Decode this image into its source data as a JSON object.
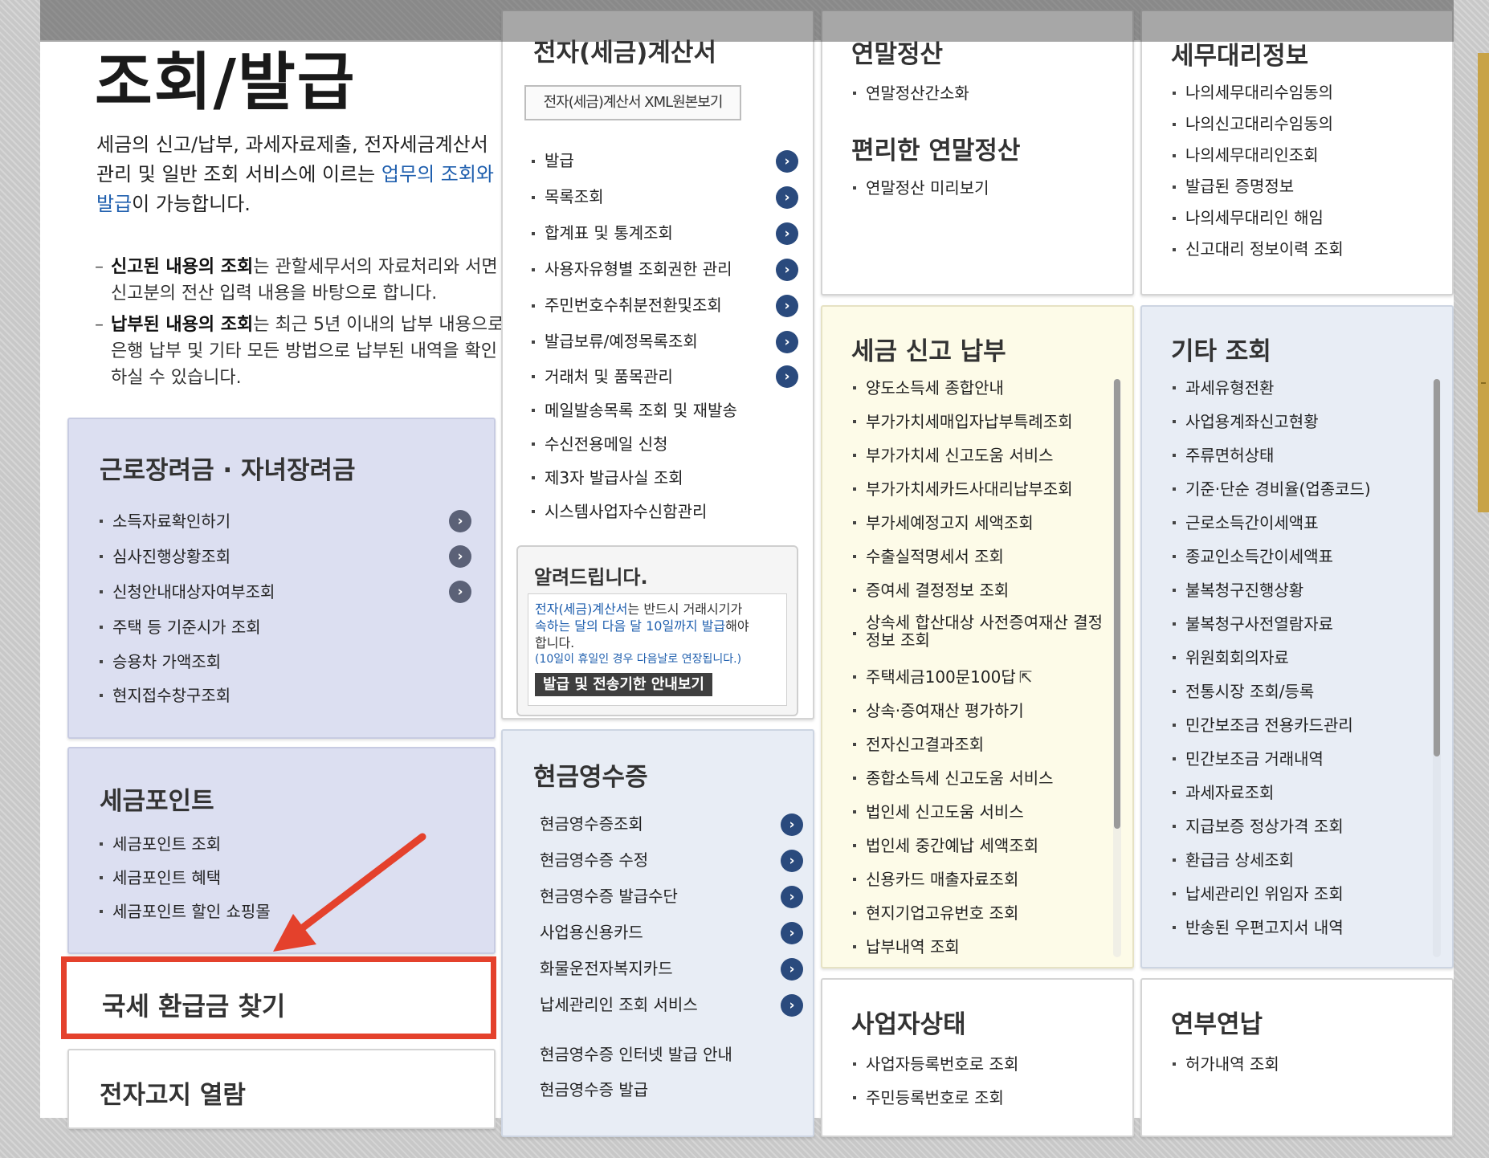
{
  "page": {
    "title": "조회/발급",
    "intro_before": "세금의 신고/납부, 과세자료제출, 전자세금계산서 관리 및 일반 조회 서비스에 이르는 ",
    "intro_highlight": "업무의 조회와 발급",
    "intro_after": "이 가능합니다.",
    "notes": [
      {
        "bold": "신고된 내용의 조회",
        "rest": "는 관할세무서의 자료처리와 서면신고분의 전산 입력 내용을 바탕으로 합니다."
      },
      {
        "bold": "납부된 내용의 조회",
        "rest": "는 최근 5년 이내의 납부 내용으로 은행 납부 및 기타 모든 방법으로 납부된 내역을 확인하실 수 있습니다."
      }
    ]
  },
  "incentive": {
    "title": "근로장려금 · 자녀장려금",
    "items": [
      "소득자료확인하기",
      "심사진행상황조회",
      "신청안내대상자여부조회",
      "주택 등 기준시가 조회",
      "승용차 가액조회",
      "현지접수창구조회"
    ]
  },
  "tax_point": {
    "title": "세금포인트",
    "items": [
      "세금포인트 조회",
      "세금포인트 혜택",
      "세금포인트 할인 쇼핑몰"
    ]
  },
  "refund": {
    "title": "국세 환급금 찾기"
  },
  "e_notice": {
    "title": "전자고지 열람"
  },
  "e_invoice": {
    "title": "전자(세금)계산서",
    "xml_button": "전자(세금)계산서 XML원본보기",
    "items": [
      "발급",
      "목록조회",
      "합계표 및 통계조회",
      "사용자유형별 조회권한 관리",
      "주민번호수취분전환및조회",
      "발급보류/예정목록조회",
      "거래처 및 품목관리",
      "메일발송목록 조회 및 재발송",
      "수신전용메일 신청",
      "제3자 발급사실 조회",
      "시스템사업자수신함관리"
    ]
  },
  "notice": {
    "title": "알려드립니다.",
    "line1_blue": "전자(세금)계산서",
    "line1_rest": "는 반드시 거래시기가",
    "line2_blue": "속하는 달의 다음 달 10일까지 발급",
    "line2_rest": "해야",
    "line3": "합니다.",
    "line4": "(10일이 휴일인 경우 다음날로 연장됩니다.)",
    "button": "발급 및 전송기한 안내보기"
  },
  "cash_receipt": {
    "title": "현금영수증",
    "items": [
      "현금영수증조회",
      "현금영수증 수정",
      "현금영수증 발급수단",
      "사업용신용카드",
      "화물운전자복지카드",
      "납세관리인 조회 서비스"
    ],
    "extra_items": [
      "현금영수증 인터넷 발급 안내",
      "현금영수증 발급"
    ]
  },
  "year_end": {
    "title": "연말정산",
    "items": [
      "연말정산간소화"
    ],
    "sub_title": "편리한 연말정산",
    "sub_items": [
      "연말정산 미리보기"
    ]
  },
  "tax_filing": {
    "title": "세금 신고 납부",
    "items": [
      "양도소득세 종합안내",
      "부가가치세매입자납부특례조회",
      "부가가치세 신고도움 서비스",
      "부가가치세카드사대리납부조회",
      "부가세예정고지 세액조회",
      "수출실적명세서 조회",
      "증여세 결정정보 조회",
      "상속세 합산대상 사전증여재산 결정",
      "주택세금100문100답",
      "상속·증여재산 평가하기",
      "전자신고결과조회",
      "종합소득세 신고도움 서비스",
      "법인세 신고도움 서비스",
      "법인세 중간예납 세액조회",
      "신용카드 매출자료조회",
      "현지기업고유번호 조회",
      "납부내역 조회"
    ],
    "item_continuation": "정보 조회"
  },
  "business_status": {
    "title": "사업자상태",
    "items": [
      "사업자등록번호로 조회",
      "주민등록번호로 조회"
    ]
  },
  "tax_agent": {
    "title": "세무대리정보",
    "items": [
      "나의세무대리수임동의",
      "나의신고대리수임동의",
      "나의세무대리인조회",
      "발급된 증명정보",
      "나의세무대리인 해임",
      "신고대리 정보이력 조회"
    ]
  },
  "other": {
    "title": "기타 조회",
    "items": [
      "과세유형전환",
      "사업용계좌신고현황",
      "주류면허상태",
      "기준·단순 경비율(업종코드)",
      "근로소득간이세액표",
      "종교인소득간이세액표",
      "불복청구진행상황",
      "불복청구사전열람자료",
      "위원회회의자료",
      "전통시장 조회/등록",
      "민간보조금 전용카드관리",
      "민간보조금 거래내역",
      "과세자료조회",
      "지급보증 정상가격 조회",
      "환급금 상세조회",
      "납세관리인 위임자 조회",
      "반송된 우편고지서 내역"
    ]
  },
  "annual_payment": {
    "title": "연부연납",
    "items": [
      "허가내역 조회"
    ]
  },
  "colors": {
    "accent_red": "#e4412c",
    "link_blue": "#1f5fae",
    "arrow_button": "#2a4a7d",
    "lavender_panel": "#dcdff1",
    "yellow_panel": "#fdfbe8",
    "blue_panel": "#e8edf5"
  }
}
